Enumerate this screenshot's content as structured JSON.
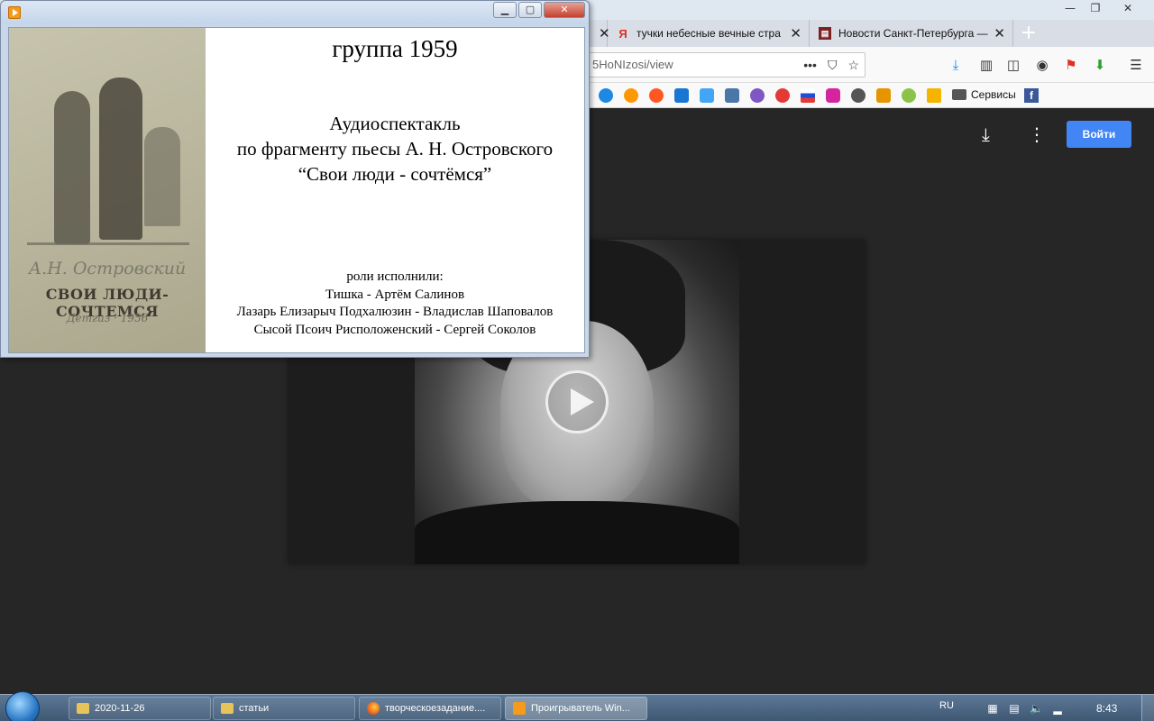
{
  "browser": {
    "tabs": [
      {
        "label": "тучки небесные вечные стра"
      },
      {
        "label": "Новости Санкт-Петербурга —"
      }
    ],
    "url": "5HoNIzosi/view",
    "bookmarks": {
      "services_label": "Сервисы"
    }
  },
  "viewer": {
    "login_label": "Войти",
    "accent_color": "#4285f4"
  },
  "player": {
    "heading": "группа 1959",
    "description_lines": [
      "Аудиоспектакль",
      "по фрагменту пьесы А. Н. Островского",
      "“Свои люди - сочтёмся”"
    ],
    "roles_title": "роли исполнили:",
    "roles": [
      "Тишка - Артём Салинов",
      "Лазарь Елизарыч Подхалюзин - Владислав Шаповалов",
      "Сысой Псоич Рисположенский - Сергей Соколов"
    ],
    "cover": {
      "author": "А.Н. Островский",
      "title": "СВОИ ЛЮДИ-СОЧТЕМСЯ",
      "publisher": "Детгиз · 1956"
    }
  },
  "taskbar": {
    "items": [
      {
        "label": "2020-11-26",
        "icon": "folder-icon"
      },
      {
        "label": "статьи",
        "icon": "folder-icon"
      },
      {
        "label": "творческоезадание....",
        "icon": "firefox-icon"
      },
      {
        "label": "Проигрыватель Win...",
        "icon": "media-player-icon"
      }
    ],
    "language": "RU",
    "time": "8:43"
  }
}
